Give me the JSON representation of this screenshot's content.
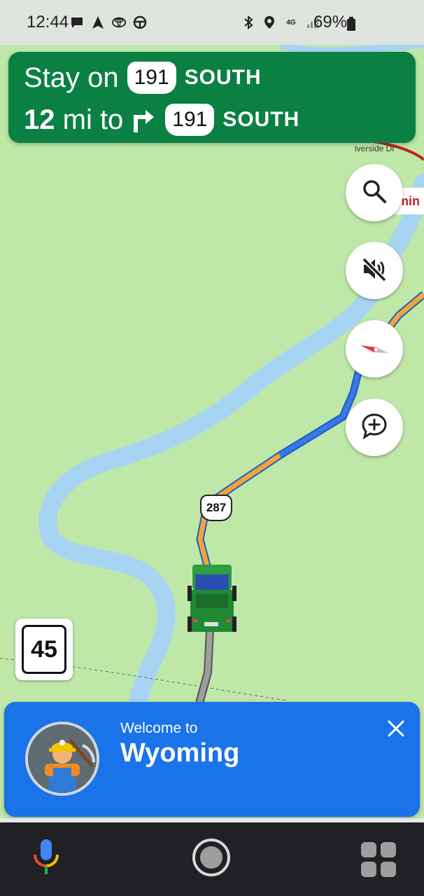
{
  "status_bar": {
    "time": "12:44",
    "battery": "69%",
    "left_icons": [
      "message-icon",
      "navigation-arrow-icon",
      "toyota-icon",
      "steering-wheel-icon"
    ],
    "right_icons": [
      "bluetooth-icon",
      "location-icon",
      "4g-lte-icon",
      "signal-icon",
      "battery-icon"
    ]
  },
  "navigation": {
    "line1_prefix": "Stay on",
    "line1_route": "191",
    "line1_direction": "SOUTH",
    "line2_distance": "12",
    "line2_unit": "mi to",
    "line2_route": "191",
    "line2_direction": "SOUTH",
    "turn_icon": "turn-right-icon",
    "color": "#0b8043"
  },
  "map": {
    "route_shield": "287",
    "street_label": "iverside Dr",
    "top_shield": "191",
    "chip_text": "min",
    "route_color": "#f6a23a",
    "traffic_color": "#3b78e7",
    "river_color": "#a8d4f3"
  },
  "map_buttons": {
    "search": "search-icon",
    "mute": "volume-off-icon",
    "compass": "compass-icon",
    "report": "add-report-icon"
  },
  "speed_limit": "45",
  "welcome": {
    "subtitle": "Welcome to",
    "title": "Wyoming",
    "color": "#1a73e8"
  },
  "bottom_bar": {
    "mic": "google-mic-icon",
    "home": "home-circle-icon",
    "apps": "app-grid-icon"
  }
}
